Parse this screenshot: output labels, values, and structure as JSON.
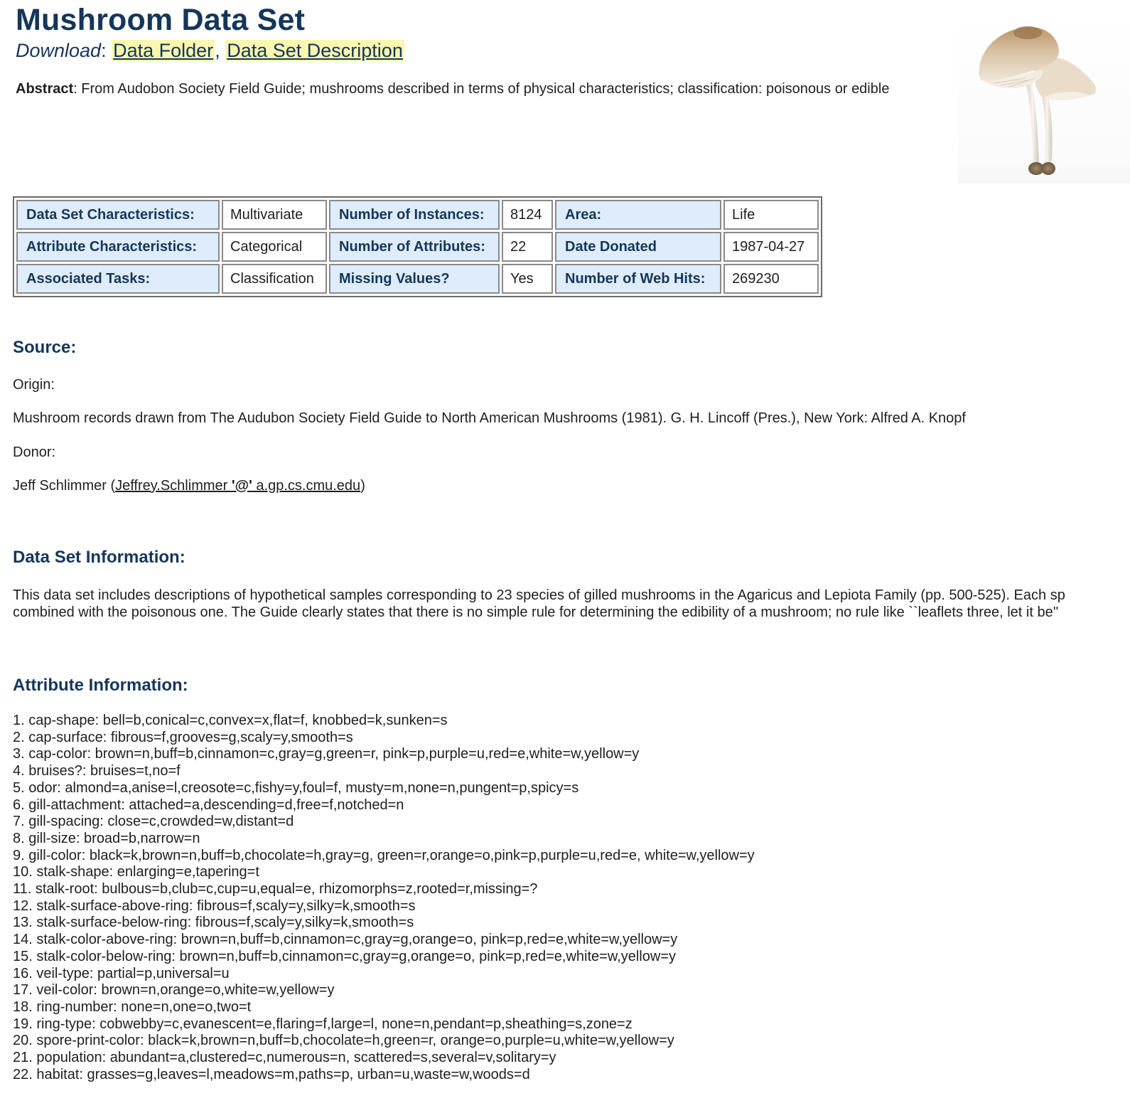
{
  "title": "Mushroom Data Set",
  "download": {
    "label": "Download",
    "sep": ":",
    "comma": ",",
    "links": [
      "Data Folder",
      "Data Set Description"
    ]
  },
  "abstract": {
    "label": "Abstract",
    "text": ": From Audobon Society Field Guide; mushrooms described in terms of physical characteristics; classification: poisonous or edible"
  },
  "specs": {
    "rows": [
      [
        {
          "label": "Data Set Characteristics:",
          "value": "Multivariate"
        },
        {
          "label": "Number of Instances:",
          "value": "8124"
        },
        {
          "label": "Area:",
          "value": "Life"
        }
      ],
      [
        {
          "label": "Attribute Characteristics:",
          "value": "Categorical"
        },
        {
          "label": "Number of Attributes:",
          "value": "22"
        },
        {
          "label": "Date Donated",
          "value": "1987-04-27"
        }
      ],
      [
        {
          "label": "Associated Tasks:",
          "value": "Classification"
        },
        {
          "label": "Missing Values?",
          "value": "Yes"
        },
        {
          "label": "Number of Web Hits:",
          "value": "269230"
        }
      ]
    ]
  },
  "source": {
    "heading": "Source:",
    "origin_label": "Origin:",
    "origin_text": "Mushroom records drawn from The Audubon Society Field Guide to North American Mushrooms (1981). G. H. Lincoff (Pres.), New York: Alfred A. Knopf",
    "donor_label": "Donor:",
    "donor_name": "Jeff Schlimmer (",
    "donor_email_user": "Jeffrey.Schlimmer ",
    "donor_email_at": "'@'",
    "donor_email_domain": " a.gp.cs.cmu.edu",
    "donor_close": ")"
  },
  "info": {
    "heading": "Data Set Information:",
    "line1": "This data set includes descriptions of hypothetical samples corresponding to 23 species of gilled mushrooms in the Agaricus and Lepiota Family (pp. 500-525). Each sp",
    "line2": "combined with the poisonous one. The Guide clearly states that there is no simple rule for determining the edibility of a mushroom; no rule like ``leaflets three, let it be''"
  },
  "attributes": {
    "heading": "Attribute Information:",
    "items": [
      "1. cap-shape: bell=b,conical=c,convex=x,flat=f, knobbed=k,sunken=s",
      "2. cap-surface: fibrous=f,grooves=g,scaly=y,smooth=s",
      "3. cap-color: brown=n,buff=b,cinnamon=c,gray=g,green=r, pink=p,purple=u,red=e,white=w,yellow=y",
      "4. bruises?: bruises=t,no=f",
      "5. odor: almond=a,anise=l,creosote=c,fishy=y,foul=f, musty=m,none=n,pungent=p,spicy=s",
      "6. gill-attachment: attached=a,descending=d,free=f,notched=n",
      "7. gill-spacing: close=c,crowded=w,distant=d",
      "8. gill-size: broad=b,narrow=n",
      "9. gill-color: black=k,brown=n,buff=b,chocolate=h,gray=g, green=r,orange=o,pink=p,purple=u,red=e, white=w,yellow=y",
      "10. stalk-shape: enlarging=e,tapering=t",
      "11. stalk-root: bulbous=b,club=c,cup=u,equal=e, rhizomorphs=z,rooted=r,missing=?",
      "12. stalk-surface-above-ring: fibrous=f,scaly=y,silky=k,smooth=s",
      "13. stalk-surface-below-ring: fibrous=f,scaly=y,silky=k,smooth=s",
      "14. stalk-color-above-ring: brown=n,buff=b,cinnamon=c,gray=g,orange=o, pink=p,red=e,white=w,yellow=y",
      "15. stalk-color-below-ring: brown=n,buff=b,cinnamon=c,gray=g,orange=o, pink=p,red=e,white=w,yellow=y",
      "16. veil-type: partial=p,universal=u",
      "17. veil-color: brown=n,orange=o,white=w,yellow=y",
      "18. ring-number: none=n,one=o,two=t",
      "19. ring-type: cobwebby=c,evanescent=e,flaring=f,large=l, none=n,pendant=p,sheathing=s,zone=z",
      "20. spore-print-color: black=k,brown=n,buff=b,chocolate=h,green=r, orange=o,purple=u,white=w,yellow=y",
      "21. population: abundant=a,clustered=c,numerous=n, scattered=s,several=v,solitary=y",
      "22. habitat: grasses=g,leaves=l,meadows=m,paths=p, urban=u,waste=w,woods=d"
    ]
  },
  "colors": {
    "heading": "#15365b",
    "label_cell_bg": "#deecfb",
    "link_highlight": "#fbf7b0",
    "text": "#1f1f1f"
  },
  "image": {
    "icon": "mushroom-photo"
  }
}
